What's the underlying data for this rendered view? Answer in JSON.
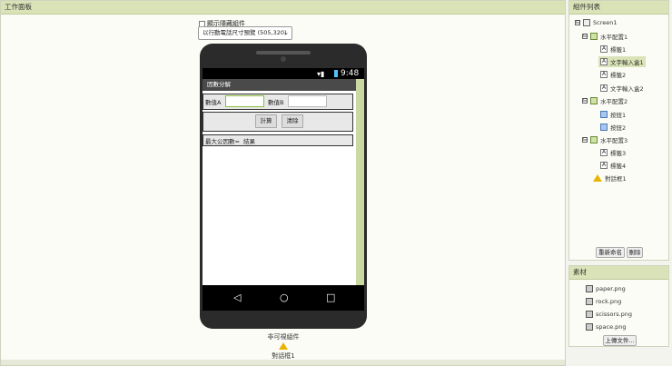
{
  "viewer": {
    "title": "工作面板",
    "show_hidden_label": "顯示隱藏組件",
    "preview_size": "以行動電話尺寸預覽 (505,320)",
    "status_time": "9:48",
    "screen_title": "因數分解",
    "row1": {
      "label_a": "數值A",
      "label_b": "數值B"
    },
    "row2": {
      "calc_button": "計算",
      "clear_button": "清除"
    },
    "row3": {
      "label": "最大公因數=",
      "result": "結果"
    },
    "nonvisible_title": "非可視組件",
    "nonvisible_item": "對話框1"
  },
  "components": {
    "title": "組件列表",
    "tree": [
      {
        "label": "Screen1",
        "icon": "screen-icon",
        "toggle": "⊟"
      },
      {
        "label": "水平配置1",
        "icon": "horizontal-arrangement-icon",
        "toggle": "⊟"
      },
      {
        "label": "標籤1",
        "icon": "label-icon"
      },
      {
        "label": "文字輸入盒1",
        "icon": "textbox-icon",
        "selected": true
      },
      {
        "label": "標籤2",
        "icon": "label-icon"
      },
      {
        "label": "文字輸入盒2",
        "icon": "textbox-icon"
      },
      {
        "label": "水平配置2",
        "icon": "horizontal-arrangement-icon",
        "toggle": "⊟"
      },
      {
        "label": "按鈕1",
        "icon": "button-icon"
      },
      {
        "label": "按鈕2",
        "icon": "button-icon"
      },
      {
        "label": "水平配置3",
        "icon": "horizontal-arrangement-icon",
        "toggle": "⊟"
      },
      {
        "label": "標籤3",
        "icon": "label-icon"
      },
      {
        "label": "標籤4",
        "icon": "label-icon"
      },
      {
        "label": "對話框1",
        "icon": "warning-icon"
      }
    ],
    "rename_button": "重新命名",
    "delete_button": "刪除"
  },
  "media": {
    "title": "素材",
    "files": [
      "paper.png",
      "rock.png",
      "scissors.png",
      "space.png"
    ],
    "upload_button": "上傳文件..."
  }
}
